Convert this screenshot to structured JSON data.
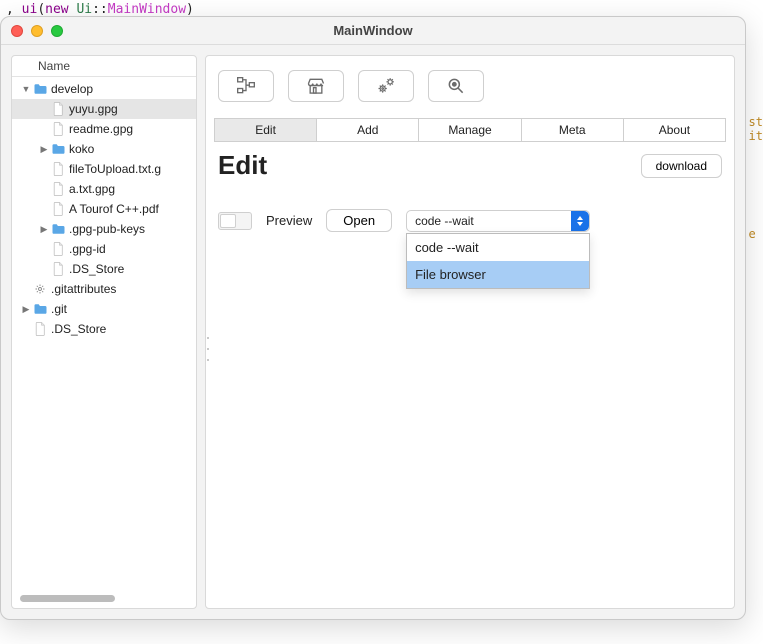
{
  "code_line": {
    "prefix": ", ",
    "kw1": "ui",
    "paren_open": "(",
    "kw2": "new ",
    "ns": "Ui",
    "sep": "::",
    "cls": "MainWindow",
    "paren_close": ")"
  },
  "bg_hint": "st\nit\n\n\n\n\n\n\ne",
  "window": {
    "title": "MainWindow"
  },
  "tree": {
    "header": "Name",
    "items": [
      {
        "depth": 0,
        "disclosure": "down",
        "icon": "folder",
        "label": "develop"
      },
      {
        "depth": 1,
        "disclosure": "none",
        "icon": "file",
        "label": "yuyu.gpg",
        "selected": true
      },
      {
        "depth": 1,
        "disclosure": "none",
        "icon": "file",
        "label": "readme.gpg"
      },
      {
        "depth": 1,
        "disclosure": "right",
        "icon": "folder",
        "label": "koko"
      },
      {
        "depth": 1,
        "disclosure": "none",
        "icon": "file",
        "label": "fileToUpload.txt.g"
      },
      {
        "depth": 1,
        "disclosure": "none",
        "icon": "file",
        "label": "a.txt.gpg"
      },
      {
        "depth": 1,
        "disclosure": "none",
        "icon": "file",
        "label": "A Tourof C++.pdf"
      },
      {
        "depth": 1,
        "disclosure": "right",
        "icon": "folder",
        "label": ".gpg-pub-keys"
      },
      {
        "depth": 1,
        "disclosure": "none",
        "icon": "file",
        "label": ".gpg-id"
      },
      {
        "depth": 1,
        "disclosure": "none",
        "icon": "file",
        "label": ".DS_Store"
      },
      {
        "depth": 0,
        "disclosure": "none",
        "icon": "gear",
        "label": ".gitattributes"
      },
      {
        "depth": 0,
        "disclosure": "right",
        "icon": "folder",
        "label": ".git"
      },
      {
        "depth": 0,
        "disclosure": "none",
        "icon": "file",
        "label": ".DS_Store"
      }
    ]
  },
  "toolbar_icons": [
    "tree-icon",
    "store-icon",
    "gears-icon",
    "magnify-icon"
  ],
  "tabs": [
    {
      "label": "Edit",
      "active": true
    },
    {
      "label": "Add",
      "active": false
    },
    {
      "label": "Manage",
      "active": false
    },
    {
      "label": "Meta",
      "active": false
    },
    {
      "label": "About",
      "active": false
    }
  ],
  "heading": "Edit",
  "download_label": "download",
  "preview_label": "Preview",
  "open_label": "Open",
  "combo": {
    "selected": "code --wait",
    "options": [
      {
        "label": "code --wait",
        "highlighted": false
      },
      {
        "label": "File browser",
        "highlighted": true
      }
    ]
  }
}
